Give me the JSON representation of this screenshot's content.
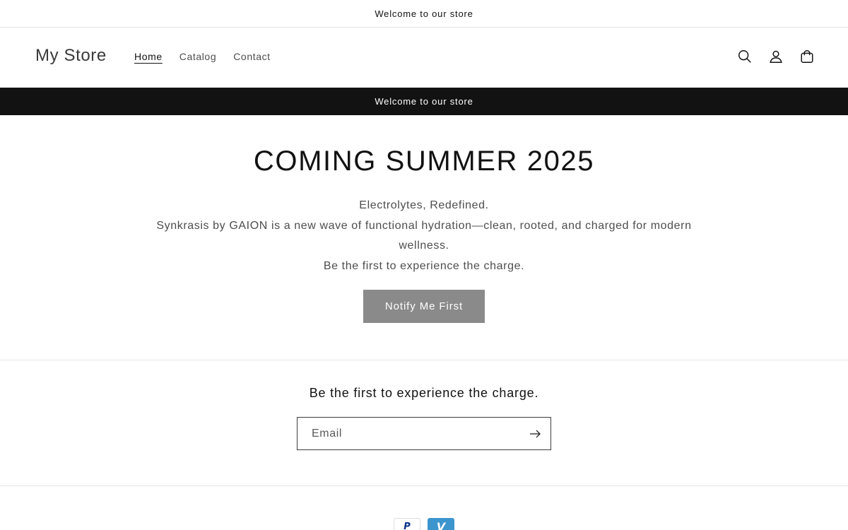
{
  "announcement_top": {
    "text": "Welcome to our store"
  },
  "header": {
    "logo": "My Store",
    "nav": [
      {
        "label": "Home",
        "active": true
      },
      {
        "label": "Catalog",
        "active": false
      },
      {
        "label": "Contact",
        "active": false
      }
    ],
    "icons": [
      "search-icon",
      "account-icon",
      "cart-icon"
    ]
  },
  "announcement_bar": {
    "text": "Welcome to our store"
  },
  "hero": {
    "title": "COMING SUMMER 2025",
    "lines": [
      "Electrolytes, Redefined.",
      "Synkrasis by GAION is a new wave of functional hydration—clean, rooted, and charged for modern wellness.",
      "Be the first to experience the charge."
    ],
    "button_label": "Notify Me First",
    "button_color": "#8a8a8a"
  },
  "newsletter": {
    "heading": "Be the first to experience the charge.",
    "email_placeholder": "Email",
    "email_value": "",
    "submit_icon": "arrow-right-icon"
  },
  "footer": {
    "payment_icons": [
      {
        "name": "paypal-icon",
        "glyph": "P"
      },
      {
        "name": "venmo-icon",
        "glyph": "V"
      }
    ]
  },
  "colors": {
    "text": "#121212",
    "muted_text": "#4d4d4d",
    "dark_bar": "#121212",
    "divider": "#e6e6e6"
  }
}
